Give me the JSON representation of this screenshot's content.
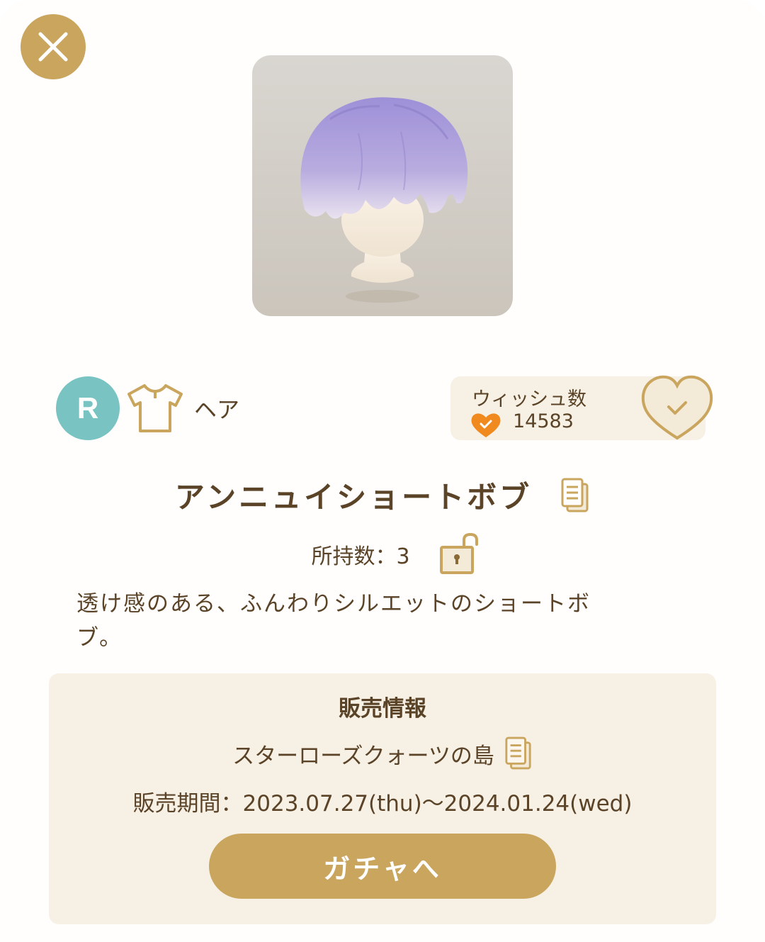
{
  "item": {
    "rarity": "R",
    "category": "ヘア",
    "name": "アンニュイショートボブ",
    "owned_label": "所持数：3",
    "description": "透け感のある、ふんわりシルエットのショートボブ。"
  },
  "wish": {
    "label": "ウィッシュ数",
    "count": "14583"
  },
  "sales": {
    "title": "販売情報",
    "island": "スターローズクォーツの島",
    "period": "販売期間：2023.07.27(thu)〜2024.01.24(wed)",
    "button_label": "ガチャへ"
  },
  "icons": {
    "close": "close-icon",
    "category": "shirt-icon",
    "wish_heart": "heart-check-icon",
    "copy": "copy-icon",
    "lock": "unlocked-padlock-icon"
  },
  "colors": {
    "accent": "#c9a55e",
    "text": "#5a4327",
    "panel": "#f7f0e5",
    "rarity_r": "#79c3c2",
    "heart_orange": "#f0891e"
  }
}
